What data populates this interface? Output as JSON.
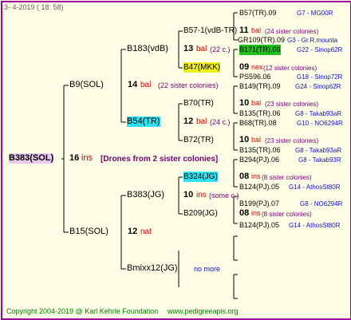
{
  "header": {
    "date": "3-  4-2019 ( 18: 58)"
  },
  "root": {
    "label": "B383(SOL)",
    "num": "16",
    "note": "ins",
    "drones": "[Drones from 2 sister colonies]"
  },
  "gen2": [
    {
      "label": "B9(SOL)",
      "num": "14",
      "note": "bal",
      "extra": "(22 sister colonies)"
    },
    {
      "label": "B15(SOL)",
      "num": "12",
      "note": "nat"
    }
  ],
  "gen3": [
    {
      "label": "B183(vdB)",
      "num": "13",
      "note": "bal",
      "extra": "(22 c.)"
    },
    {
      "label": "B54(TR)",
      "num": "12",
      "note": "bal",
      "extra": "(24 c.)"
    },
    {
      "label": "B383(JG)",
      "num": "10",
      "note": "ins",
      "extra": "(some c.)"
    },
    {
      "label": "Bmixx12(JG)",
      "extra": "no more"
    }
  ],
  "gen4": [
    {
      "label": "B57-1(vdB-TR)",
      "num": "11",
      "note": "bal",
      "extra": "(24 sister colonies)"
    },
    {
      "label": "B47(MKK)",
      "num": "09",
      "note": "nex",
      "extra": "(12 sister colonies)"
    },
    {
      "label": "B70(TR)",
      "num": "10",
      "note": "bal",
      "extra": "(23 sister colonies)"
    },
    {
      "label": "B72(TR)",
      "num": "10",
      "note": "bal",
      "extra": "(23 sister colonies)"
    },
    {
      "label": "B324(JG)",
      "num": "08",
      "note": "ins",
      "extra": "(8 sister colonies)"
    },
    {
      "label": "B209(JG)",
      "num": "08",
      "note": "ins",
      "extra": "(8 sister colonies)"
    }
  ],
  "gen5": [
    {
      "label": "B57(TR).09",
      "info": "G7 - MG00R"
    },
    {
      "label": "GR109(TR).09",
      "info": "G3 - Gr.R.mounta"
    },
    {
      "label": "B171(TR).06",
      "info": "G22 - Sinop62R"
    },
    {
      "label": "PS596.06",
      "info": "G18 - Sinop72R"
    },
    {
      "label": "B149(TR).09",
      "info": "G24 - Sinop62R"
    },
    {
      "label": "B135(TR).06",
      "info": "G8 - Takab93aR"
    },
    {
      "label": "B68(TR).08",
      "info": "G10 - NO6294R"
    },
    {
      "label": "B135(TR).06",
      "info": "G8 - Takab93aR"
    },
    {
      "label": "B294(PJ).06",
      "info": "G8 - Takab93R"
    },
    {
      "label": "B124(PJ).05",
      "info": "G14 - AthosSt80R"
    },
    {
      "label": "B199(PJ).07",
      "info": "G8 - NO6294R"
    },
    {
      "label": "B124(PJ).05",
      "info": "G14 - AthosSt80R"
    }
  ],
  "footer": {
    "copyright": "Copyright 2004-2019 @ Karl Kehrle Foundation",
    "site": "www.pedigreeapis.org"
  }
}
